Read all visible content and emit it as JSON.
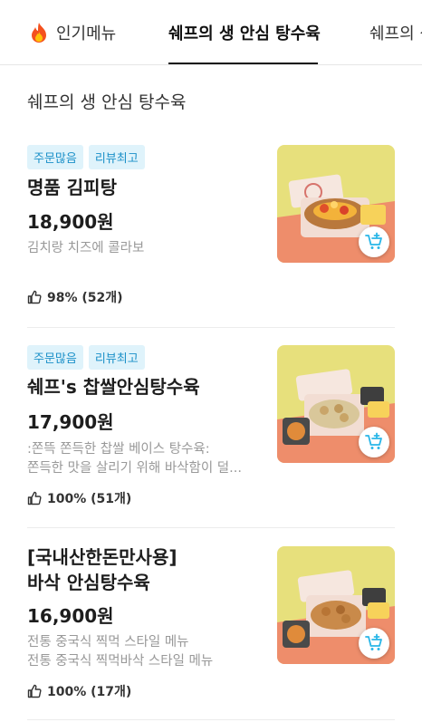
{
  "tabs": [
    {
      "label": "인기메뉴",
      "icon": "fire-icon"
    },
    {
      "label": "쉐프의 생 안심 탕수육",
      "active": true
    },
    {
      "label": "쉐프의 생"
    }
  ],
  "section": {
    "title": "쉐프의 생 안심 탕수육"
  },
  "items": [
    {
      "badges": [
        "주문많음",
        "리뷰최고"
      ],
      "name_lines": [
        "명품 김피탕"
      ],
      "price": "18,900원",
      "desc_lines": [
        "김치랑 치즈에 콜라보"
      ],
      "rating": "98% (52개)",
      "image": "food-photo-kimpitang"
    },
    {
      "badges": [
        "주문많음",
        "리뷰최고"
      ],
      "name_lines": [
        "쉐프's 찹쌀안심탕수육"
      ],
      "price": "17,900원",
      "desc_lines": [
        ":쫀뜩 쫀득한 찹쌀 베이스 탕수육:",
        "쫀득한 맛을 살리기 위해 바삭함이 덜..."
      ],
      "rating": "100% (51개)",
      "image": "food-photo-chapssal"
    },
    {
      "badges": [],
      "name_lines": [
        "[국내산한돈만사용]",
        "바삭 안심탕수육"
      ],
      "price": "16,900원",
      "desc_lines": [
        "전통 중국식 찍먹 스타일 메뉴",
        "전통 중국식 찍먹바삭 스타일 메뉴"
      ],
      "rating": "100% (17개)",
      "image": "food-photo-basak"
    }
  ],
  "colors": {
    "badge_text": "#1a90c8",
    "badge_bg": "#dff3fb",
    "cart_icon": "#29b6e8",
    "photo_bg": "#e9e27a"
  }
}
